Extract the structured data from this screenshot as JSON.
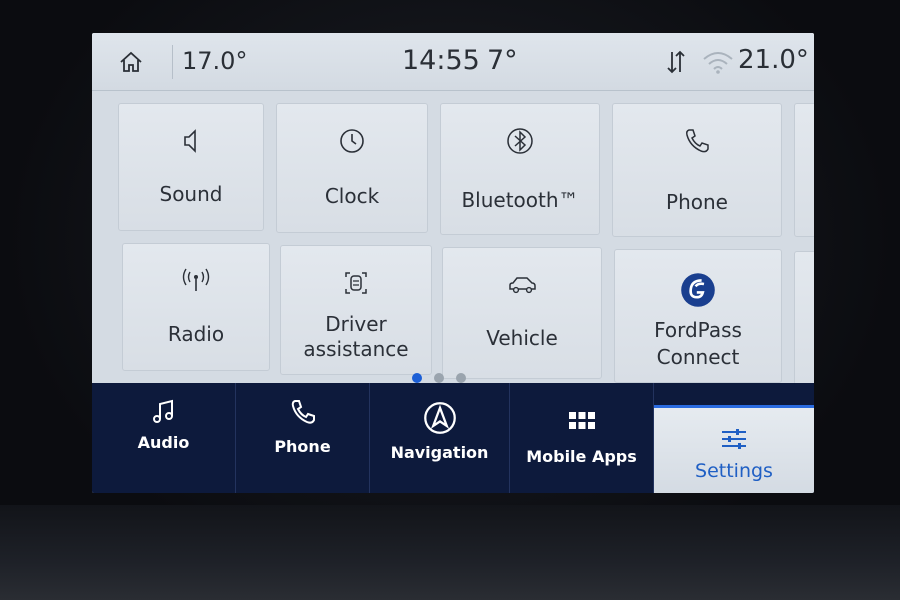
{
  "status_bar": {
    "inside_temp_left": "17.0°",
    "time": "14:55",
    "outside_temp": "7°",
    "inside_temp_right": "21.0°"
  },
  "tiles": [
    {
      "label": "Sound",
      "icon": "speaker-icon"
    },
    {
      "label": "Clock",
      "icon": "clock-icon"
    },
    {
      "label": "Bluetooth™",
      "icon": "bluetooth-icon"
    },
    {
      "label": "Phone",
      "icon": "phone-icon"
    },
    {
      "label": "Radio",
      "icon": "radio-antenna-icon"
    },
    {
      "label": "Driver",
      "label2": "assistance",
      "icon": "driver-assist-icon"
    },
    {
      "label": "Vehicle",
      "icon": "car-icon"
    },
    {
      "label": "FordPass",
      "label2": "Connect",
      "icon": "fordpass-icon"
    }
  ],
  "page_indicator": {
    "current": 1,
    "total": 3
  },
  "nav": [
    {
      "label": "Audio",
      "icon": "music-note-icon"
    },
    {
      "label": "Phone",
      "icon": "phone-icon"
    },
    {
      "label": "Navigation",
      "icon": "navigation-arrow-icon"
    },
    {
      "label": "Mobile Apps",
      "icon": "apps-grid-icon"
    },
    {
      "label": "Settings",
      "icon": "sliders-icon",
      "active": true
    }
  ],
  "colors": {
    "accent": "#1c5fd6",
    "nav_background": "#0d1a3c",
    "tile_background": "#dfe5eb"
  }
}
